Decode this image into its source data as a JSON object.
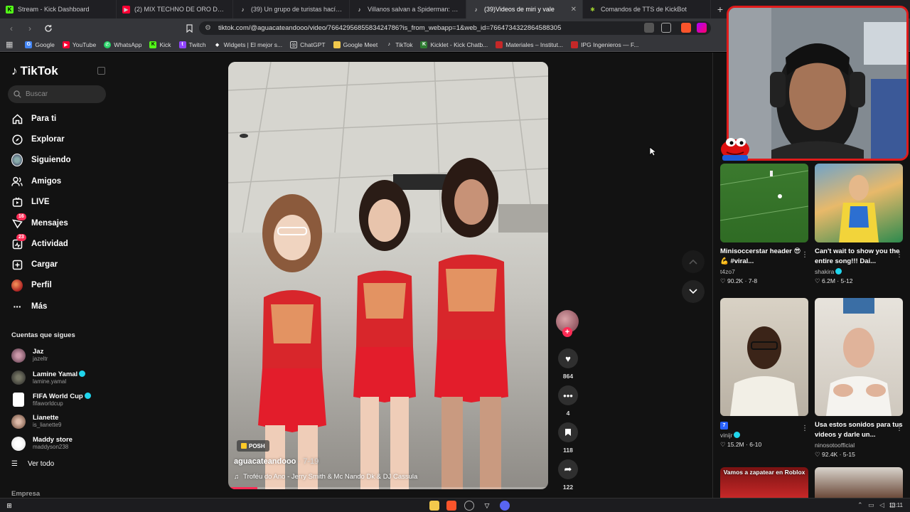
{
  "browser": {
    "tabs": [
      {
        "title": "Stream - Kick Dashboard",
        "icon": "kick-icon",
        "color": "#53fc18",
        "active": false
      },
      {
        "title": "(2) MIX TECHNO DE ORO DE 80's &",
        "icon": "youtube-icon",
        "color": "#ff0033",
        "active": false
      },
      {
        "title": "(39) Un grupo de turistas hacía fo",
        "icon": "tiktok-icon",
        "color": "#000000",
        "active": false
      },
      {
        "title": "Villanos salvan a Spiderman: Duende",
        "icon": "tiktok-icon",
        "color": "#000000",
        "active": false
      },
      {
        "title": "(39)Videos de miri y vale",
        "icon": "tiktok-icon",
        "color": "#000000",
        "active": true
      },
      {
        "title": "Comandos de TTS de KickBot",
        "icon": "kickbot-icon",
        "color": "#9ccc2f",
        "active": false
      }
    ],
    "url": "tiktok.com/@aguacateandooo/video/7664295685583424786?is_from_webapp=1&web_id=7664734322864588305",
    "bookmarks": [
      {
        "label": "Google",
        "icon": "google-icon",
        "color": "#4285f4"
      },
      {
        "label": "YouTube",
        "icon": "youtube-icon",
        "color": "#ff0033"
      },
      {
        "label": "WhatsApp",
        "icon": "whatsapp-icon",
        "color": "#25d366"
      },
      {
        "label": "Kick",
        "icon": "kick-icon",
        "color": "#53fc18"
      },
      {
        "label": "Twitch",
        "icon": "twitch-icon",
        "color": "#9146ff"
      },
      {
        "label": "Widgets | El mejor s...",
        "icon": "widgets-icon",
        "color": "#ffffff"
      },
      {
        "label": "ChatGPT",
        "icon": "chatgpt-icon",
        "color": "#ffffff"
      },
      {
        "label": "Google Meet",
        "icon": "folder-icon",
        "color": "#f2c94c"
      },
      {
        "label": "TikTok",
        "icon": "tiktok-icon",
        "color": "#000000"
      },
      {
        "label": "Kicklet - Kick Chatb...",
        "icon": "kicklet-icon",
        "color": "#53fc18"
      },
      {
        "label": "Materiales – Institut...",
        "icon": "materiales-icon",
        "color": "#c62828"
      },
      {
        "label": "IPG Ingenieros — F...",
        "icon": "ipg-icon",
        "color": "#c62828"
      }
    ]
  },
  "tiktok": {
    "brand": "TikTok",
    "search_placeholder": "Buscar",
    "nav": [
      {
        "label": "Para ti",
        "icon": "home-icon",
        "badge": ""
      },
      {
        "label": "Explorar",
        "icon": "compass-icon",
        "badge": ""
      },
      {
        "label": "Siguiendo",
        "icon": "following-icon",
        "badge": ""
      },
      {
        "label": "Amigos",
        "icon": "friends-icon",
        "badge": ""
      },
      {
        "label": "LIVE",
        "icon": "live-icon",
        "badge": ""
      },
      {
        "label": "Mensajes",
        "icon": "messages-icon",
        "badge": "16"
      },
      {
        "label": "Actividad",
        "icon": "activity-icon",
        "badge": "23"
      },
      {
        "label": "Cargar",
        "icon": "upload-icon",
        "badge": ""
      },
      {
        "label": "Perfil",
        "icon": "profile-icon",
        "badge": ""
      },
      {
        "label": "Más",
        "icon": "more-icon",
        "badge": ""
      }
    ],
    "following_title": "Cuentas que sigues",
    "following": [
      {
        "name": "Jaz",
        "handle": "jazeltr",
        "verified": false
      },
      {
        "name": "Lamine Yamal",
        "handle": "lamine.yamal",
        "verified": true
      },
      {
        "name": "FIFA World Cup",
        "handle": "fifaworldcup",
        "verified": true
      },
      {
        "name": "Lianette",
        "handle": "is_lianette9",
        "verified": false
      },
      {
        "name": "Maddy store",
        "handle": "maddyson238",
        "verified": false
      }
    ],
    "see_all": "Ver todo",
    "footer_section": "Empresa",
    "video": {
      "tag": "POSH",
      "author": "aguacateandooo",
      "date": "7-19",
      "music": "Troféu do Ano - Jerry Smith & Mc Nando Dk & DJ Cassula",
      "likes": "864",
      "comments": "4",
      "saves": "118",
      "shares": "122",
      "progress": 0.09
    },
    "feed": [
      {
        "title": "Minisoccerstar header 😎💪 #viral...",
        "author": "t4zo7",
        "verified": false,
        "views": "90.2K",
        "date": "7-8"
      },
      {
        "title": "Can't wait to show you the entire song!!! Dai...",
        "author": "shakira",
        "verified": true,
        "views": "6.2M",
        "date": "5-12"
      },
      {
        "title": "7",
        "author": "vinijr",
        "verified": true,
        "views": "15.2M",
        "date": "6-10"
      },
      {
        "title": "Usa estos sonidos para tus videos y darle un...",
        "author": "ninosotoofficial",
        "verified": false,
        "views": "92.4K",
        "date": "5-15"
      },
      {
        "title": "Vamos a zapatear en Roblox",
        "author": "",
        "verified": false,
        "views": "",
        "date": ""
      }
    ]
  },
  "taskbar": {
    "clock": "13:11"
  },
  "colors": {
    "accent": "#fe2c55",
    "verified": "#20d5ec",
    "cam_border": "#e01b1b"
  }
}
